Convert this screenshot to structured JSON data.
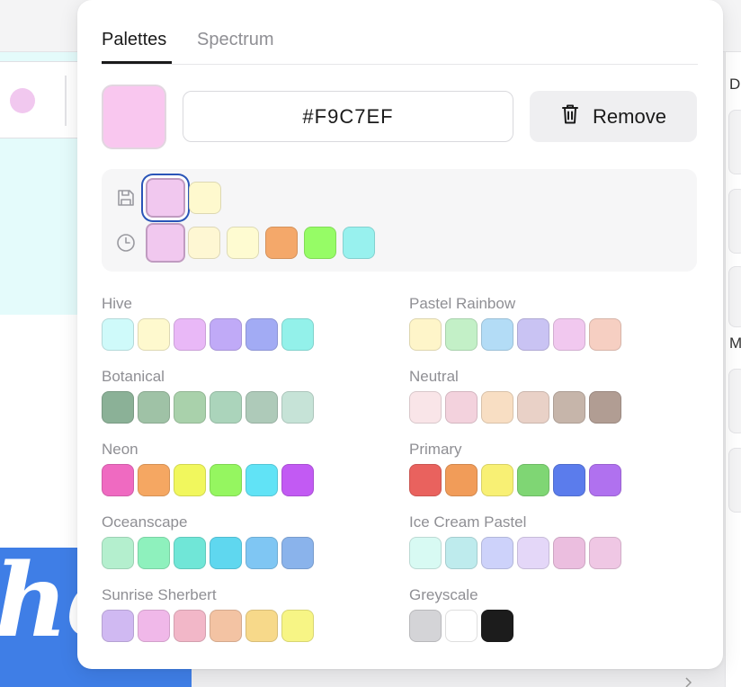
{
  "tabs": {
    "palettes": "Palettes",
    "spectrum": "Spectrum"
  },
  "current_color": "#F9C7EF",
  "hex_value": "#F9C7EF",
  "remove_label": "Remove",
  "icons": {
    "trash": "trash-icon",
    "save": "save-icon",
    "history": "clock-icon"
  },
  "saved_colors": [
    "#F1C8EF",
    "#FEF9CE"
  ],
  "recent_colors": [
    "#F1C8EF",
    "#FEF7D3",
    "#FEFBD1",
    "#F4A86A",
    "#96FC66",
    "#98F1EE"
  ],
  "palettes": [
    {
      "name": "Hive",
      "colors": [
        "#CFFAFA",
        "#FEF9CE",
        "#E9B8F7",
        "#C0AAF7",
        "#A2ABF4",
        "#93F1EA"
      ]
    },
    {
      "name": "Pastel Rainbow",
      "colors": [
        "#FEF5C9",
        "#C3F0C7",
        "#B3DCF6",
        "#C9C3F3",
        "#F1C8EF",
        "#F6CFC2"
      ]
    },
    {
      "name": "Botanical",
      "colors": [
        "#8BB197",
        "#9FC2A6",
        "#A9D1AB",
        "#ABD4BB",
        "#AECAB9",
        "#C6E3D7"
      ]
    },
    {
      "name": "Neutral",
      "colors": [
        "#F9E5E8",
        "#F3D2DD",
        "#F8DEC3",
        "#E9D1C7",
        "#C6B5AA",
        "#B19D93"
      ]
    },
    {
      "name": "Neon",
      "colors": [
        "#EF6AC1",
        "#F5A762",
        "#F1F75D",
        "#95F660",
        "#61E3F6",
        "#C25AF3"
      ]
    },
    {
      "name": "Primary",
      "colors": [
        "#E9625E",
        "#F19C59",
        "#F8F074",
        "#7FD674",
        "#5B7CEC",
        "#B071EF"
      ]
    },
    {
      "name": "Oceanscape",
      "colors": [
        "#B4EFCE",
        "#8EF1BD",
        "#70E6D7",
        "#5FD7EF",
        "#7FC6F3",
        "#8AB3EB"
      ]
    },
    {
      "name": "Ice Cream Pastel",
      "colors": [
        "#D8FAF3",
        "#BEEBED",
        "#CDD2FA",
        "#E4D7F8",
        "#EBBEDF",
        "#EFC7E4"
      ]
    },
    {
      "name": "Sunrise Sherbert",
      "colors": [
        "#D0B9F2",
        "#F0B8E9",
        "#F2B7C8",
        "#F3C3A3",
        "#F7D98A",
        "#F7F585"
      ]
    },
    {
      "name": "Greyscale",
      "colors": [
        "#D4D4D7",
        "#FFFFFF",
        "#1C1C1C"
      ]
    }
  ],
  "background": {
    "toolbar_dot_color": "#F1C8EF",
    "blue_card_text": "he",
    "right_letters": [
      "D",
      "M"
    ]
  }
}
